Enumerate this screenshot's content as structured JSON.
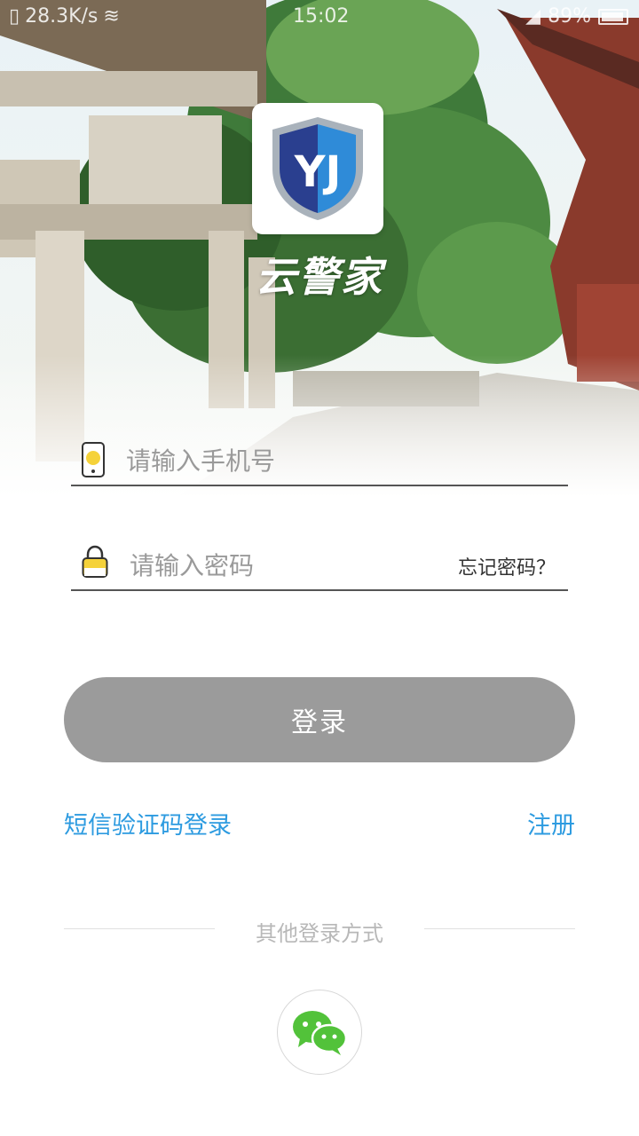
{
  "status_bar": {
    "net_speed": "28.3K/s",
    "time": "15:02",
    "battery": "89%"
  },
  "app": {
    "logo_text": "YJ",
    "name": "云警家"
  },
  "form": {
    "phone_placeholder": "请输入手机号",
    "password_placeholder": "请输入密码",
    "forgot_label": "忘记密码？",
    "login_label": "登录"
  },
  "links": {
    "sms_login": "短信验证码登录",
    "register": "注册"
  },
  "other": {
    "label": "其他登录方式",
    "wechat": "wechat-icon"
  },
  "colors": {
    "accent": "#2d9be0",
    "login_button": "#9b9b9b",
    "wechat_green": "#52c23a",
    "logo_blue": "#2a3f8f"
  }
}
